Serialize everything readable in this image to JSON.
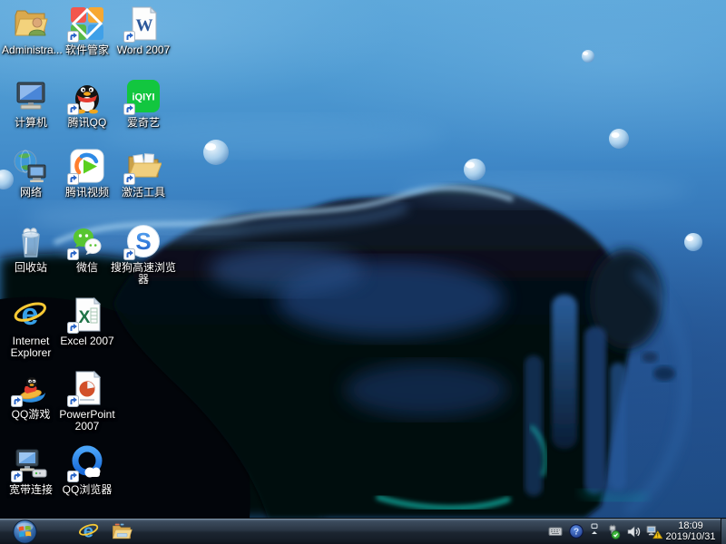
{
  "desktop": {
    "icons": [
      {
        "name": "administrator-folder",
        "label": "Administra...",
        "shortcut": false
      },
      {
        "name": "software-manager",
        "label": "软件管家",
        "shortcut": true
      },
      {
        "name": "word-2007",
        "label": "Word 2007",
        "shortcut": true,
        "glyph": "W"
      },
      {
        "name": "computer",
        "label": "计算机",
        "shortcut": false
      },
      {
        "name": "tencent-qq",
        "label": "腾讯QQ",
        "shortcut": true
      },
      {
        "name": "iqiyi",
        "label": "爱奇艺",
        "shortcut": true,
        "glyph": "iQIYI"
      },
      {
        "name": "network",
        "label": "网络",
        "shortcut": false
      },
      {
        "name": "tencent-video",
        "label": "腾讯视频",
        "shortcut": true
      },
      {
        "name": "activation-tools",
        "label": "激活工具",
        "shortcut": true
      },
      {
        "name": "recycle-bin",
        "label": "回收站",
        "shortcut": false
      },
      {
        "name": "wechat",
        "label": "微信",
        "shortcut": true
      },
      {
        "name": "sogou-browser",
        "label": "搜狗高速浏览器",
        "shortcut": true,
        "glyph": "S"
      },
      {
        "name": "internet-explorer",
        "label": "Internet Explorer",
        "shortcut": false,
        "glyph": "e"
      },
      {
        "name": "excel-2007",
        "label": "Excel 2007",
        "shortcut": true,
        "glyph": "X"
      },
      {
        "name": "qq-games",
        "label": "QQ游戏",
        "shortcut": true
      },
      {
        "name": "powerpoint-2007",
        "label": "PowerPoint 2007",
        "shortcut": true
      },
      {
        "name": "broadband-connection",
        "label": "宽带连接",
        "shortcut": true
      },
      {
        "name": "qq-browser",
        "label": "QQ浏览器",
        "shortcut": true
      }
    ]
  },
  "taskbar": {
    "pinned": [
      {
        "name": "internet-explorer-taskbar",
        "glyph": "e"
      },
      {
        "name": "windows-explorer-taskbar"
      }
    ],
    "tray": {
      "icons": [
        {
          "name": "input-method-keyboard"
        },
        {
          "name": "help",
          "glyph": "?"
        },
        {
          "name": "show-hidden-icons"
        },
        {
          "name": "safely-remove-hardware"
        },
        {
          "name": "volume"
        },
        {
          "name": "network-warning",
          "glyph": "!"
        }
      ],
      "clock": {
        "time": "18:09",
        "date": "2019/10/31"
      }
    }
  },
  "colors": {
    "water_light": "#60aadc",
    "water_deep": "#1d4a82",
    "splash_dark": "#04080e",
    "teal_accent": "#17d8c8",
    "taskbar": "#232d3a",
    "label_text": "#ffffff",
    "iqiyi_green": "#12c63f",
    "wechat_green": "#57c531",
    "qq_red": "#e33b30",
    "word_blue": "#2b579a",
    "excel_green": "#1f7246",
    "ppt_orange": "#d2502a"
  }
}
